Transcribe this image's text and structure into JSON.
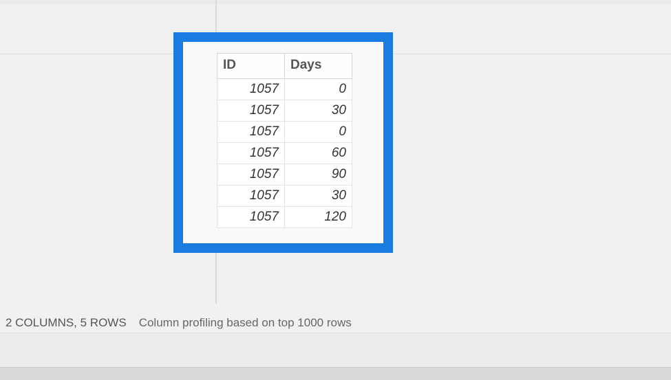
{
  "table": {
    "headers": [
      "ID",
      "Days"
    ],
    "rows": [
      {
        "id": "1057",
        "days": "0"
      },
      {
        "id": "1057",
        "days": "30"
      },
      {
        "id": "1057",
        "days": "0"
      },
      {
        "id": "1057",
        "days": "60"
      },
      {
        "id": "1057",
        "days": "90"
      },
      {
        "id": "1057",
        "days": "30"
      },
      {
        "id": "1057",
        "days": "120"
      }
    ]
  },
  "statusbar": {
    "summary": "2 COLUMNS, 5 ROWS",
    "profiling": "Column profiling based on top 1000 rows"
  }
}
